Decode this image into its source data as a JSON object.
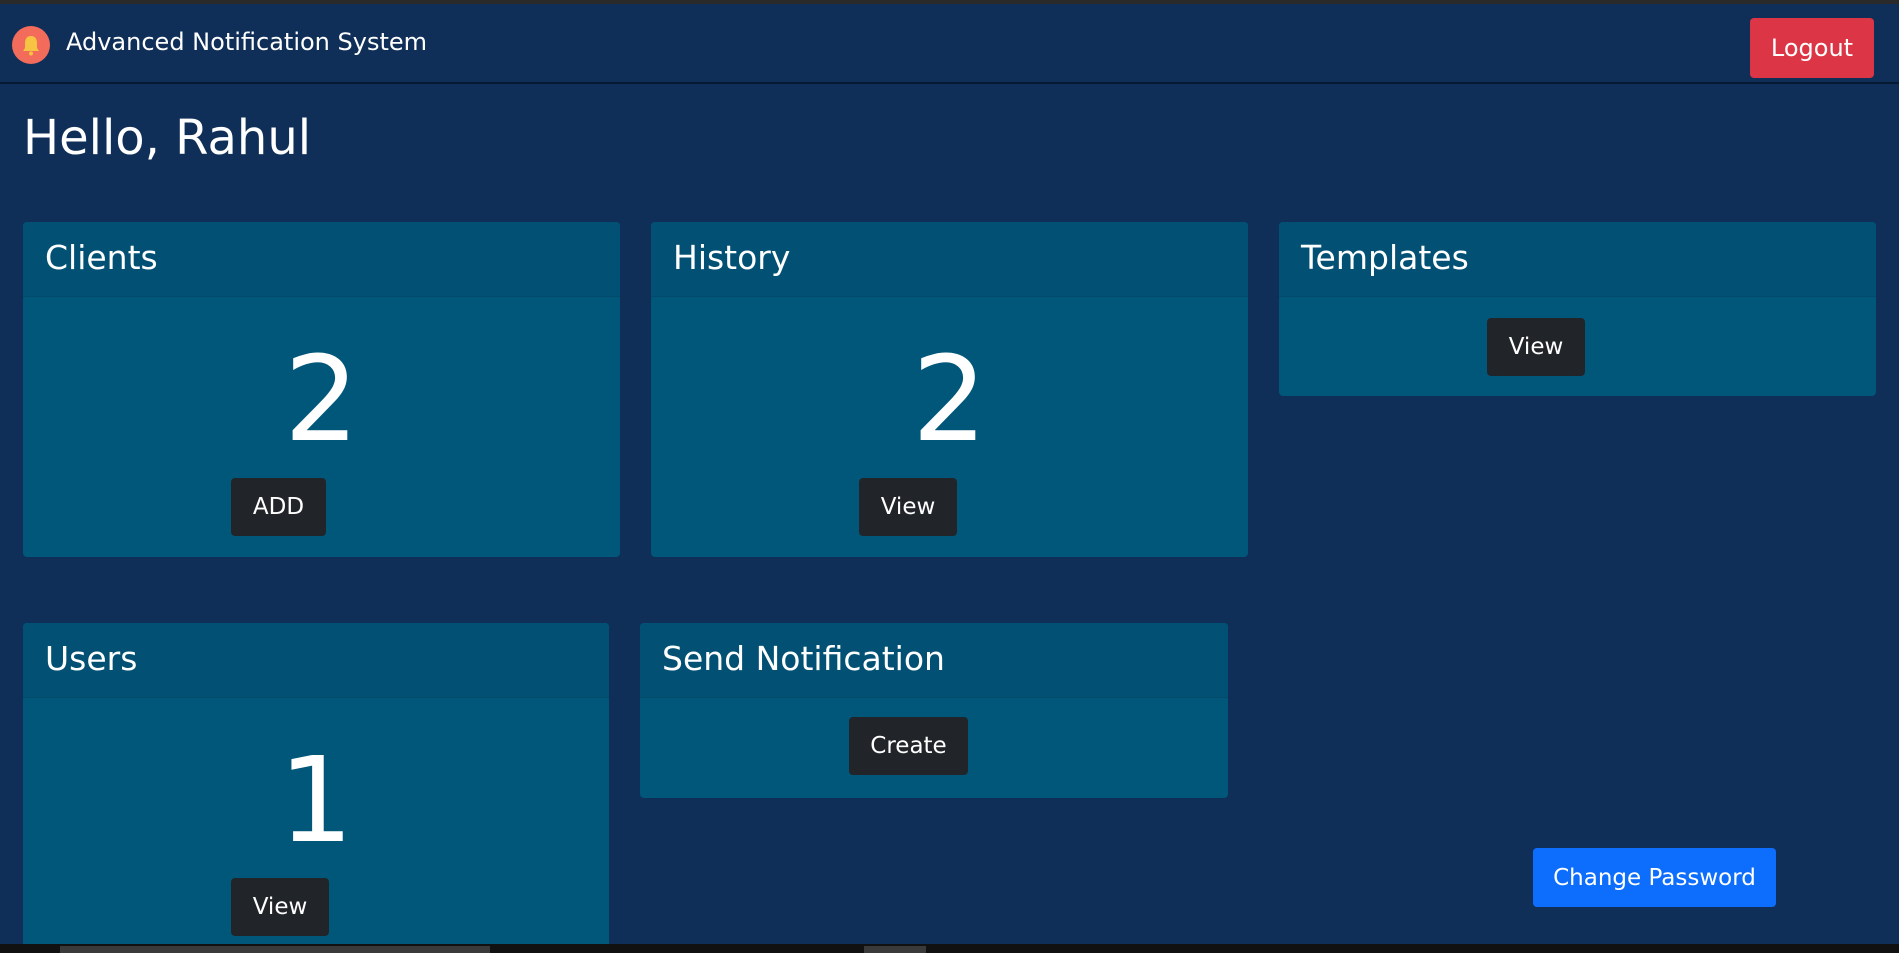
{
  "header": {
    "app_title": "Advanced Notification System",
    "logo_icon": "bell-icon",
    "logout_label": "Logout"
  },
  "greeting": "Hello, Rahul",
  "cards": {
    "clients": {
      "title": "Clients",
      "count": "2",
      "button": "ADD"
    },
    "history": {
      "title": "History",
      "count": "2",
      "button": "View"
    },
    "templates": {
      "title": "Templates",
      "button": "View"
    },
    "users": {
      "title": "Users",
      "count": "1",
      "button": "View"
    },
    "send_notification": {
      "title": "Send Notification",
      "button": "Create"
    }
  },
  "change_password_label": "Change Password",
  "colors": {
    "background": "#0f2f58",
    "card": "#00577a",
    "logout": "#dc3545",
    "primary": "#0d6efd",
    "dark_button": "#212529",
    "logo": "#f26b5b"
  }
}
